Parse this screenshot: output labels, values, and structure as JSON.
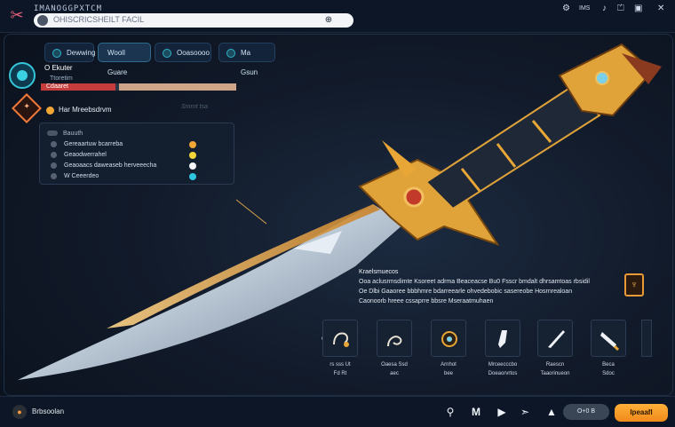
{
  "app": {
    "title": "IMANOGGPXTCM"
  },
  "search": {
    "value": "OHISCRICSHEILT FACIL"
  },
  "top_right": {
    "items": [
      "IMS"
    ]
  },
  "tabs": [
    {
      "label": "Dewwing"
    },
    {
      "label": "Wooll Guare"
    },
    {
      "label": "Ooasoooo"
    },
    {
      "label": "Ma Gsun"
    }
  ],
  "profile": {
    "name": "O Ekuter",
    "sub": "Ttoretim",
    "bar_label": "Cdaaret",
    "health_fraction": 0.38
  },
  "section": {
    "title": "Har Mreebsdrvm",
    "note": "Smrnt tsa",
    "icon": "sparkle-icon"
  },
  "stats": {
    "header": "Bauuth",
    "rows": [
      {
        "label": "Gereaartuw bcarreba",
        "color": "#f2a636"
      },
      {
        "label": "Geaodwerrahel",
        "color": "#f5d63a"
      },
      {
        "label": "Geaoaacs daweaseb herveeecha",
        "color": "#f4f6f9"
      },
      {
        "label": "W Ceeerdeo",
        "color": "#2fc6e0"
      }
    ]
  },
  "description": {
    "title": "Kraelsmuecos",
    "lines": [
      "Ooa aclusrmsdimte Ksoreet adrma Beaceacse Bu0 Fsscr bmdalt dhrsamtoas rbsidil",
      "Oe Dlbi Gaaoree bbbhmre bdarreearle ohvedebobic sasereobe Hosrnrealoan",
      "Caonoorb hreee cssaprre bbsre Mseraatmuhaen"
    ]
  },
  "equipment_slots": [
    {
      "label": "rs sss Ut",
      "sub": "Fd Rt",
      "icon": "gauntlet-icon"
    },
    {
      "label": "Oaesa Ssd",
      "sub": "aec",
      "icon": "serpent-icon"
    },
    {
      "label": "Arnhot",
      "sub": "bee",
      "icon": "amulet-icon"
    },
    {
      "label": "Mrceecccbo",
      "sub": "Doeaorvrtos",
      "icon": "boot-icon"
    },
    {
      "label": "Raescn",
      "sub": "Taaorinueon",
      "icon": "dagger-icon"
    },
    {
      "label": "Beca",
      "sub": "Sdoc",
      "icon": "blade-icon"
    }
  ],
  "bottom": {
    "label": "Brbsoolan",
    "controls": [
      "M",
      "▶"
    ],
    "secondary": "O+0 B",
    "primary": "Ipeaafl"
  },
  "colors": {
    "accent": "#ff9a2a",
    "cyan": "#35c5d9",
    "danger": "#c43c3c",
    "gold": "#e8a636"
  }
}
